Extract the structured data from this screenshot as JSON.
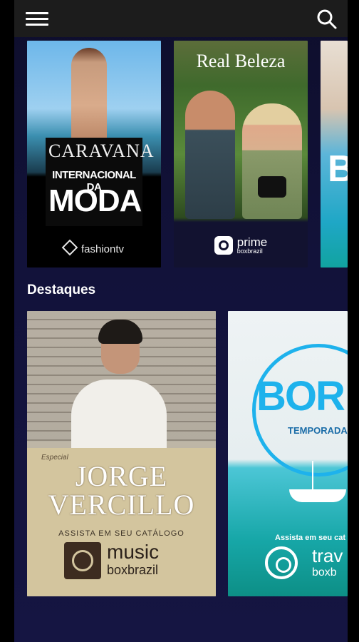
{
  "topbar": {
    "menu_icon": "hamburger-menu-icon",
    "search_icon": "search-icon"
  },
  "carousel": [
    {
      "title": "CARAVANA",
      "subtitle": "INTERNACIONAL DA",
      "emphasis": "MODA",
      "brand": "fashiontv"
    },
    {
      "title": "Real Beleza",
      "brand_top": "prime",
      "brand_bottom": "boxbrazil"
    },
    {
      "title": "B"
    }
  ],
  "featured": {
    "section_title": "Destaques",
    "items": [
      {
        "small": "Especial",
        "name_line1": "JORGE",
        "name_line2": "VERCILLO",
        "cta": "ASSISTA EM SEU CATÁLOGO",
        "brand_top": "music",
        "brand_bottom": "boxbrazil"
      },
      {
        "title": "BOR",
        "subtitle": "TEMPORADA",
        "cta": "Assista em seu cat",
        "brand_top": "trav",
        "brand_bottom": "boxb"
      }
    ]
  },
  "colors": {
    "background": "#12123a",
    "topbar": "#1c1c1c",
    "accent_blue": "#1eb2ec"
  }
}
